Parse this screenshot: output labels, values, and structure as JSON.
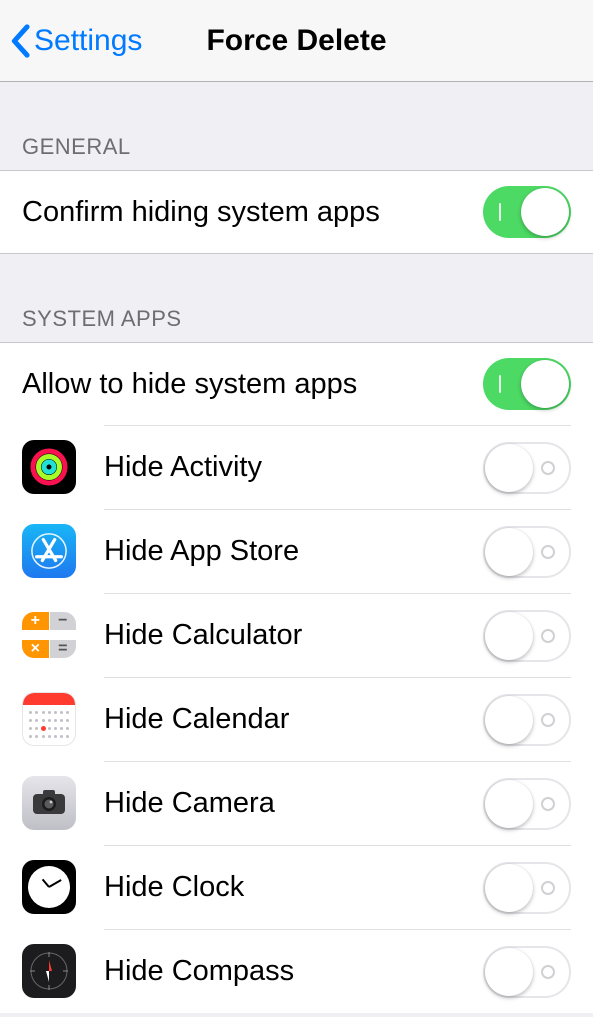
{
  "nav": {
    "back_label": "Settings",
    "title": "Force Delete"
  },
  "sections": {
    "general": {
      "header": "General",
      "confirm_label": "Confirm hiding system apps",
      "confirm_on": true
    },
    "system_apps": {
      "header": "System Apps",
      "allow_label": "Allow to hide system apps",
      "allow_on": true,
      "apps": [
        {
          "id": "activity",
          "label": "Hide Activity",
          "on": false
        },
        {
          "id": "appstore",
          "label": "Hide App Store",
          "on": false
        },
        {
          "id": "calculator",
          "label": "Hide Calculator",
          "on": false
        },
        {
          "id": "calendar",
          "label": "Hide Calendar",
          "on": false
        },
        {
          "id": "camera",
          "label": "Hide Camera",
          "on": false
        },
        {
          "id": "clock",
          "label": "Hide Clock",
          "on": false
        },
        {
          "id": "compass",
          "label": "Hide Compass",
          "on": false
        }
      ]
    }
  },
  "colors": {
    "tint": "#007aff",
    "switch_on": "#4cd964"
  }
}
